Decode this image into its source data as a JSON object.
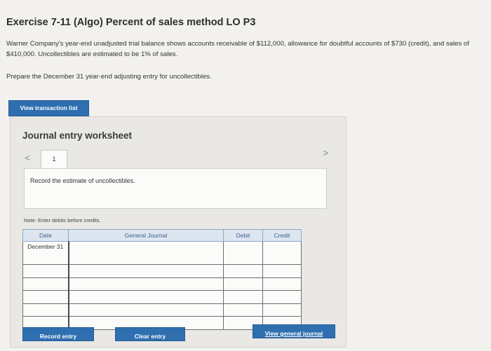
{
  "exercise": {
    "title": "Exercise 7-11 (Algo) Percent of sales method LO P3",
    "description": "Warner Company's year-end unadjusted trial balance shows accounts receivable of $112,000, allowance for doubtful accounts of $730 (credit), and sales of $410,000. Uncollectibles are estimated to be 1% of sales.",
    "instruction": "Prepare the December 31 year-end adjusting entry for uncollectibles."
  },
  "buttons": {
    "view_transaction_list": "View transaction list",
    "record_entry": "Record entry",
    "clear_entry": "Clear entry",
    "view_general_journal": "View general journal"
  },
  "worksheet": {
    "title": "Journal entry worksheet",
    "current_tab": "1",
    "nav_prev": "<",
    "nav_next": ">",
    "instruction": "Record the estimate of uncollectibles.",
    "note": "Note: Enter debits before credits."
  },
  "journal_table": {
    "headers": {
      "date": "Date",
      "general_journal": "General Journal",
      "debit": "Debit",
      "credit": "Credit"
    },
    "rows": [
      {
        "date": "December 31",
        "account": "",
        "debit": "",
        "credit": ""
      },
      {
        "date": "",
        "account": "",
        "debit": "",
        "credit": ""
      },
      {
        "date": "",
        "account": "",
        "debit": "",
        "credit": ""
      },
      {
        "date": "",
        "account": "",
        "debit": "",
        "credit": ""
      },
      {
        "date": "",
        "account": "",
        "debit": "",
        "credit": ""
      },
      {
        "date": "",
        "account": "",
        "debit": "",
        "credit": ""
      }
    ]
  },
  "colors": {
    "primary_button": "#2f6fb0",
    "table_header_bg": "#dde6f0",
    "table_header_text": "#3f5e8a"
  }
}
